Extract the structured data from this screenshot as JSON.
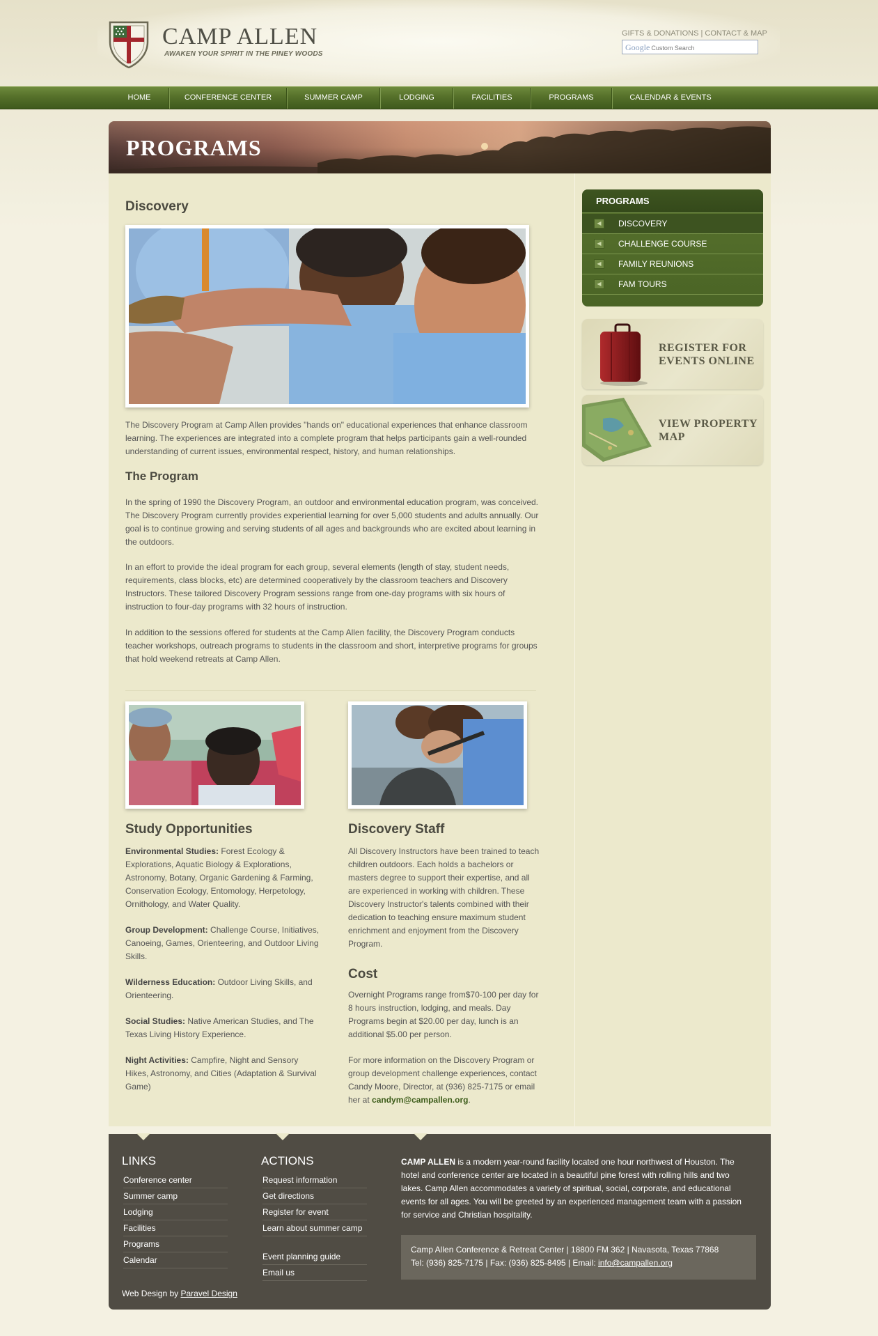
{
  "header": {
    "logo_title": "CAMP ALLEN",
    "logo_tagline": "AWAKEN YOUR SPIRIT IN THE PINEY WOODS",
    "top_links": [
      "GIFTS & DONATIONS",
      "CONTACT & MAP"
    ],
    "top_links_sep": " | ",
    "search_brand": "Google",
    "search_placeholder": "Custom Search"
  },
  "nav": {
    "items": [
      "HOME",
      "CONFERENCE CENTER",
      "SUMMER CAMP",
      "LODGING",
      "FACILITIES",
      "PROGRAMS",
      "CALENDAR & EVENTS"
    ]
  },
  "banner": {
    "title": "PROGRAMS"
  },
  "main": {
    "heading": "Discovery",
    "intro": "The Discovery Program at Camp Allen provides \"hands on\" educational experiences that enhance classroom learning. The experiences are integrated into a complete program that helps participants gain a well-rounded understanding of current issues, environmental respect, history, and human relationships.",
    "program_heading": "The Program",
    "program_paras": [
      "In the spring of 1990 the Discovery Program, an outdoor and environmental education program, was conceived. The Discovery Program currently provides experiential learning for over 5,000 students and adults annually. Our goal is to continue growing and serving students of all ages and backgrounds who are excited about learning in the outdoors.",
      "In an effort to provide the ideal program for each group, several elements (length of stay, student needs, requirements, class blocks, etc) are determined cooperatively by the classroom teachers and Discovery Instructors. These tailored Discovery Program sessions range from one-day programs with six hours of instruction to four-day programs with 32 hours of instruction.",
      "In addition to the sessions offered for students at the Camp Allen facility, the Discovery Program conducts teacher workshops, outreach programs to students in the classroom and short, interpretive programs for groups that hold weekend retreats at Camp Allen."
    ],
    "study_heading": "Study Opportunities",
    "study_items": [
      {
        "label": "Environmental Studies:",
        "text": " Forest Ecology & Explorations, Aquatic Biology & Explorations, Astronomy, Botany, Organic Gardening & Farming, Conservation Ecology, Entomology, Herpetology, Ornithology, and Water Quality."
      },
      {
        "label": "Group Development:",
        "text": " Challenge Course, Initiatives, Canoeing, Games, Orienteering, and Outdoor Living Skills."
      },
      {
        "label": "Wilderness Education:",
        "text": " Outdoor Living Skills, and Orienteering."
      },
      {
        "label": "Social Studies:",
        "text": " Native American Studies, and The Texas Living History Experience."
      },
      {
        "label": "Night Activities:",
        "text": " Campfire, Night and Sensory Hikes, Astronomy, and Cities (Adaptation & Survival Game)"
      }
    ],
    "staff_heading": "Discovery Staff",
    "staff_text": "All Discovery Instructors have been trained to teach children outdoors. Each holds a bachelors or masters degree to support their expertise, and all are experienced in working with children. These Discovery Instructor's talents combined with their dedication to teaching ensure maximum student enrichment and enjoyment from the Discovery Program.",
    "cost_heading": "Cost",
    "cost_text": "Overnight Programs range from$70-100 per day for 8 hours instruction, lodging, and meals. Day Programs begin at $20.00 per day, lunch is an additional $5.00 per person.",
    "contact_text": "For more information on the Discovery Program or group development challenge experiences, contact Candy Moore, Director, at (936) 825-7175 or email her at ",
    "contact_email": "candym@campallen.org",
    "contact_end": "."
  },
  "sidebar": {
    "menu_title": "PROGRAMS",
    "menu_items": [
      "DISCOVERY",
      "CHALLENGE COURSE",
      "FAMILY REUNIONS",
      "FAM TOURS"
    ],
    "promo_register": [
      "REGISTER FOR",
      "EVENTS ONLINE"
    ],
    "promo_map": [
      "VIEW PROPERTY",
      "MAP"
    ]
  },
  "footer": {
    "links_heading": "LINKS",
    "links": [
      "Conference center",
      "Summer camp",
      "Lodging",
      "Facilities",
      "Programs",
      "Calendar"
    ],
    "actions_heading": "ACTIONS",
    "actions": [
      "Request information",
      "Get directions",
      "Register for event",
      "Learn about summer camp",
      "Event planning guide",
      "Email us"
    ],
    "about_name": "CAMP ALLEN",
    "about_text": " is a modern year-round facility located one hour northwest of Houston. The hotel and conference center are located in a beautiful pine forest with rolling hills and two lakes. Camp Allen accommodates a variety of spiritual, social, corporate, and educational events for all ages. You will be greeted by an experienced management team with a passion for service and Christian hospitality.",
    "address": "Camp Allen Conference & Retreat Center | 18800 FM 362 | Navasota, Texas 77868",
    "phone": "Tel: (936) 825-7175 | Fax: (936) 825-8495 | Email: ",
    "email": "info@campallen.org",
    "credit_prefix": "Web Design by ",
    "credit_link": "Paravel Design"
  },
  "colors": {
    "nav_green": "#55702a",
    "content_bg": "#ece9cc",
    "footer_bg": "#504c44",
    "link_green": "#3d5c1a"
  }
}
